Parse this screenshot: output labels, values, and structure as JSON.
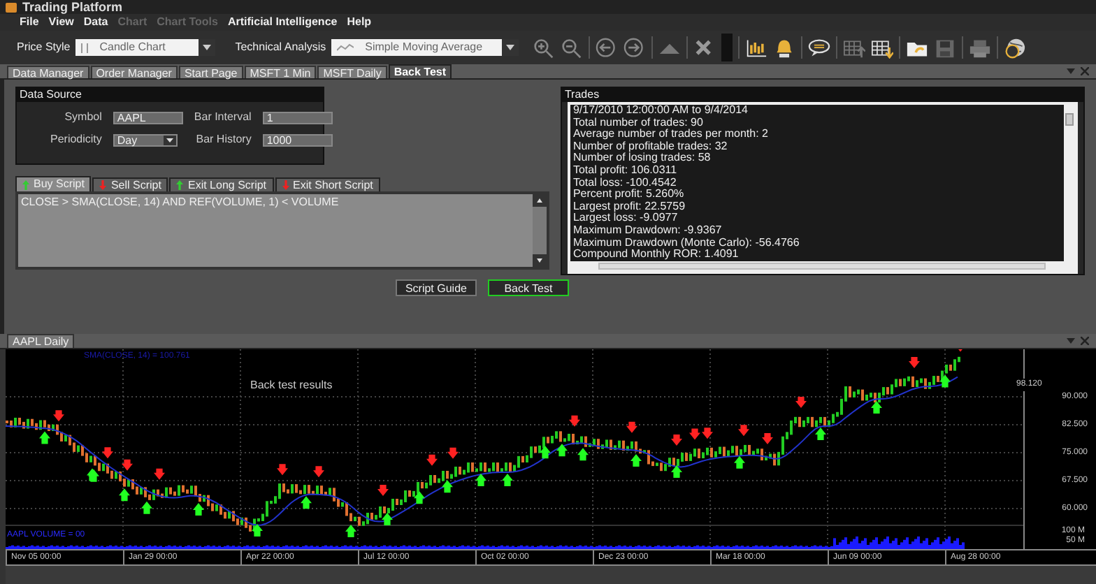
{
  "window": {
    "title": "Trading Platform"
  },
  "menu": [
    {
      "label": "File",
      "disabled": false
    },
    {
      "label": "View",
      "disabled": false
    },
    {
      "label": "Data",
      "disabled": false
    },
    {
      "label": "Chart",
      "disabled": true
    },
    {
      "label": "Chart Tools",
      "disabled": true
    },
    {
      "label": "Artificial Intelligence",
      "disabled": false
    },
    {
      "label": "Help",
      "disabled": false
    }
  ],
  "toolbar": {
    "price_style": {
      "label": "Price Style",
      "value": "Candle Chart"
    },
    "technical_analysis": {
      "label": "Technical Analysis",
      "value": "Simple Moving Average"
    }
  },
  "doc_tabs": [
    {
      "label": "Data Manager",
      "selected": false
    },
    {
      "label": "Order Manager",
      "selected": false
    },
    {
      "label": "Start Page",
      "selected": false
    },
    {
      "label": "MSFT 1 Min",
      "selected": false
    },
    {
      "label": "MSFT Daily",
      "selected": false
    },
    {
      "label": "Back Test",
      "selected": true
    }
  ],
  "data_source": {
    "title": "Data Source",
    "fields": [
      {
        "label": "Symbol",
        "value": "AAPL",
        "kind": "text"
      },
      {
        "label": "Bar Interval",
        "value": "1",
        "kind": "text"
      },
      {
        "label": "Periodicity",
        "value": "Day",
        "kind": "select"
      },
      {
        "label": "Bar History",
        "value": "1000",
        "kind": "text"
      }
    ]
  },
  "script_tabs": [
    {
      "label": "Buy Script",
      "kind": "up",
      "selected": true
    },
    {
      "label": "Sell Script",
      "kind": "down",
      "selected": false
    },
    {
      "label": "Exit Long Script",
      "kind": "up",
      "selected": false
    },
    {
      "label": "Exit Short Script",
      "kind": "down",
      "selected": false
    }
  ],
  "script": "CLOSE > SMA(CLOSE, 14) AND REF(VOLUME, 1) < VOLUME",
  "buttons": [
    {
      "label": "Script Guide",
      "highlighted": false
    },
    {
      "label": "Back Test",
      "highlighted": true
    }
  ],
  "trades": {
    "title": "Trades",
    "lines": [
      "9/17/2010 12:00:00 AM to 9/4/2014",
      "Total number of trades: 90",
      "Average number of trades per month: 2",
      "Number of profitable trades: 32",
      "Number of losing trades: 58",
      "Total profit: 106.0311",
      "Total loss: -100.4542",
      "Percent profit: 5.260%",
      "Largest profit: 22.5759",
      "Largest loss: -9.0977",
      "Maximum Drawdown: -9.9367",
      "Maximum Drawdown (Monte Carlo): -56.4766",
      "Compound Monthly ROR: 1.4091"
    ]
  },
  "chart": {
    "tab": "AAPL Daily",
    "sma_label": "SMA(CLOSE, 14) = 100.761",
    "annotation": "Back test results",
    "volume_label": "AAPL VOLUME = 00",
    "last_price": "98.120",
    "price_ticks": [
      "90.000",
      "82.500",
      "75.000",
      "67.500",
      "60.000"
    ],
    "volume_ticks": [
      "100 M",
      "50 M"
    ],
    "dates": [
      "Nov 05 00:00",
      "Jan 29 00:00",
      "Apr 22 00:00",
      "Jul 12 00:00",
      "Oct 02 00:00",
      "Dec 23 00:00",
      "Mar 18 00:00",
      "Jun 09 00:00",
      "Aug 28 00:00"
    ]
  }
}
